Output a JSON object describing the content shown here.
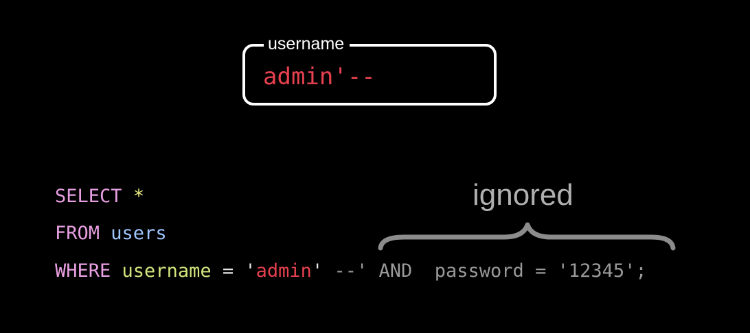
{
  "field": {
    "label": "username",
    "value": "admin'--"
  },
  "annotation": {
    "label": "ignored"
  },
  "sql": {
    "line1": {
      "keyword": "SELECT",
      "star": "*"
    },
    "line2": {
      "keyword": "FROM",
      "table": "users"
    },
    "line3": {
      "keyword": "WHERE",
      "column": "username",
      "equals": "=",
      "quote_open": "'",
      "value": "admin",
      "quote_close": "'",
      "ignored_text": "--' AND  password = '12345';"
    }
  },
  "colors": {
    "background": "#000000",
    "keyword": "#e9a0e3",
    "table": "#9ec6ff",
    "column": "#d2e67e",
    "string": "#e8414f",
    "ignored": "#9a9a9a",
    "box_border": "#ffffff"
  }
}
